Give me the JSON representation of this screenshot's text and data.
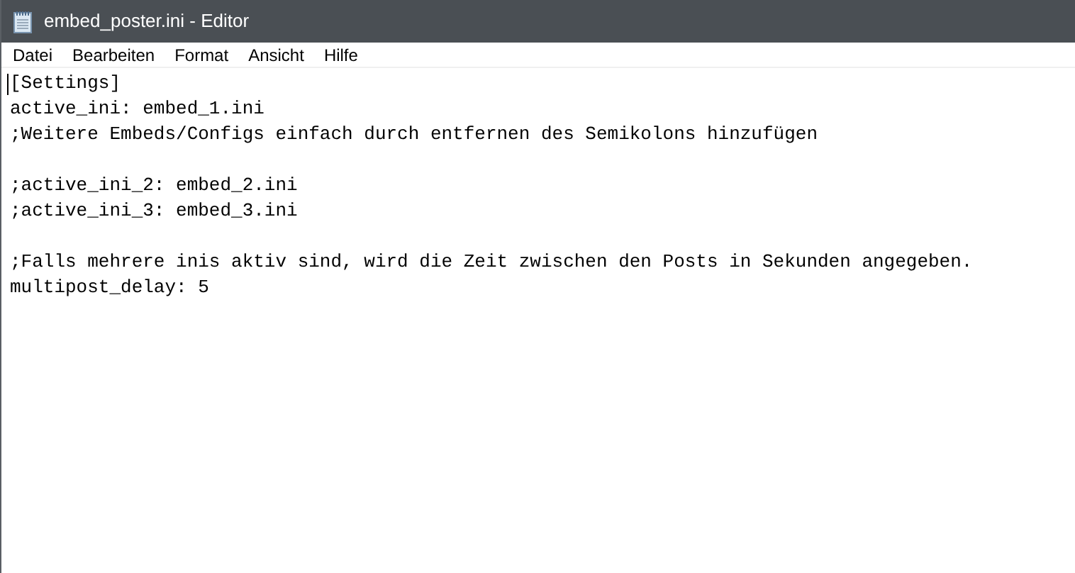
{
  "window": {
    "title": "embed_poster.ini - Editor"
  },
  "menu": [
    "Datei",
    "Bearbeiten",
    "Format",
    "Ansicht",
    "Hilfe"
  ],
  "editor": {
    "blocks": [
      [
        "[Settings]",
        "active_ini: embed_1.ini",
        ";Weitere Embeds/Configs einfach durch entfernen des Semikolons hinzufügen"
      ],
      [
        ";active_ini_2: embed_2.ini",
        ";active_ini_3: embed_3.ini"
      ],
      [
        ";Falls mehrere inis aktiv sind, wird die Zeit zwischen den Posts in Sekunden angegeben.",
        "multipost_delay: 5"
      ]
    ]
  }
}
